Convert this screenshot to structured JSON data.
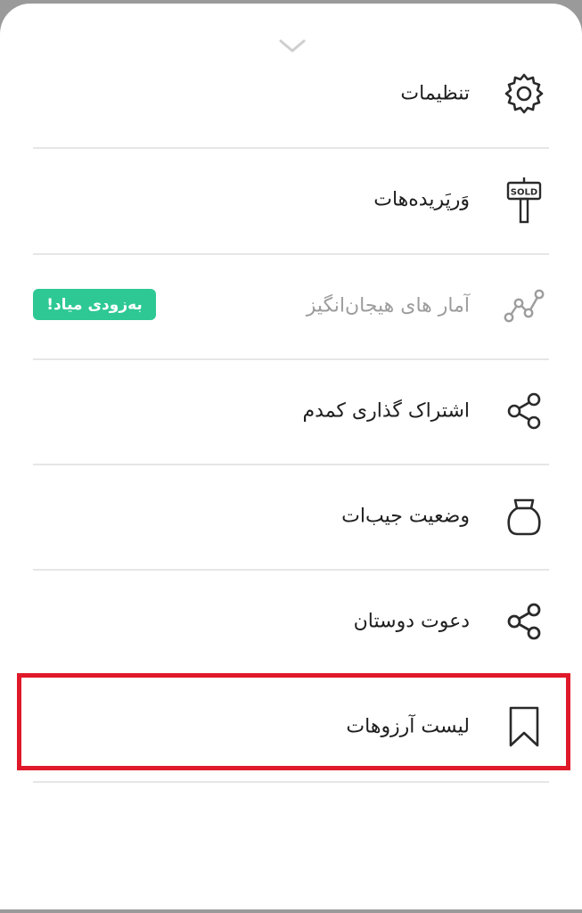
{
  "menu": {
    "items": [
      {
        "id": "settings",
        "label": "تنظیمات",
        "icon": "gear-icon",
        "enabled": true
      },
      {
        "id": "sold",
        "label": "وَرپَریده‌هات",
        "icon": "sold-sign-icon",
        "icon_text": "SOLD",
        "enabled": true
      },
      {
        "id": "stats",
        "label": "آمار های هیجان‌انگیز",
        "icon": "chart-line-icon",
        "enabled": false,
        "badge": "به‌زودی میاد!"
      },
      {
        "id": "share",
        "label": "اشتراک گذاری کمدم",
        "icon": "share-icon",
        "enabled": true
      },
      {
        "id": "wallet",
        "label": "وضعیت جیب‌ات",
        "icon": "money-bag-icon",
        "enabled": true
      },
      {
        "id": "invite",
        "label": "دعوت دوستان",
        "icon": "share-icon",
        "enabled": true
      },
      {
        "id": "wishlist",
        "label": "لیست آرزوهات",
        "icon": "bookmark-icon",
        "enabled": true,
        "highlighted": true
      }
    ]
  },
  "colors": {
    "badge_bg": "#2ec894",
    "highlight_border": "#e0192a",
    "text": "#1e1e1e",
    "disabled_text": "#9d9d9d",
    "divider": "#e6e6e6"
  }
}
